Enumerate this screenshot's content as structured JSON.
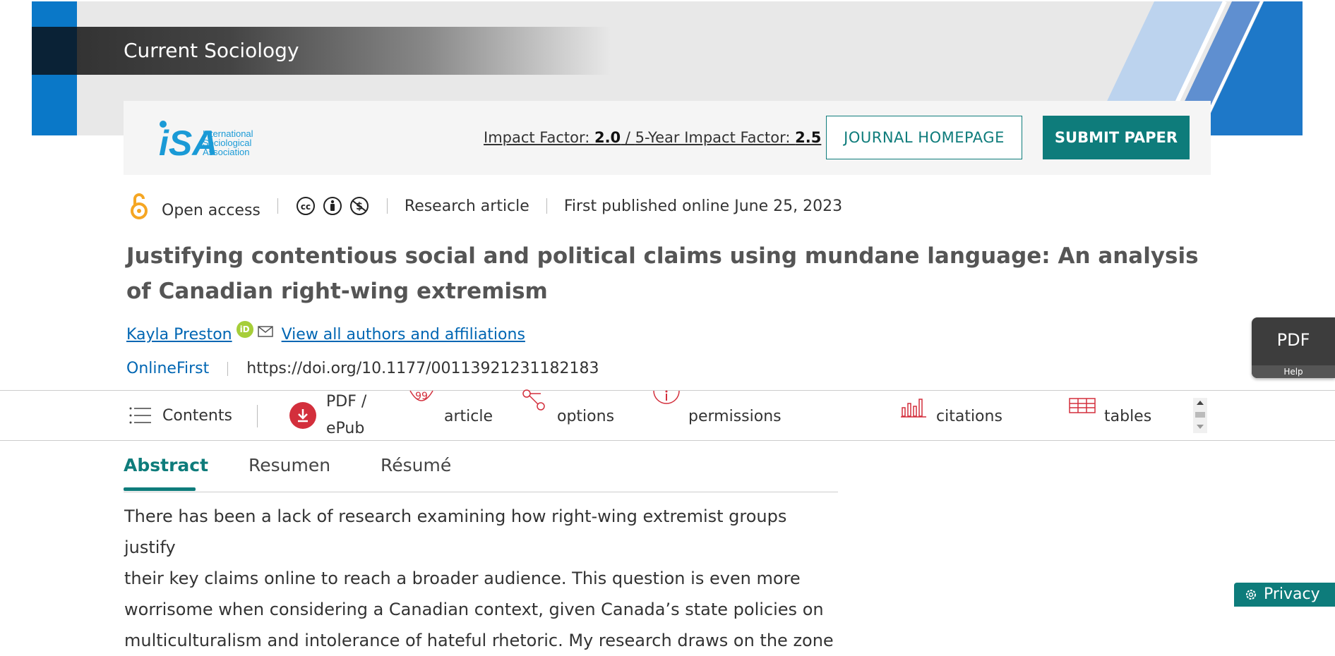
{
  "banner": {
    "journal_title": "Current Sociology"
  },
  "infobar": {
    "logo_text_lines": [
      "International",
      "Sociological",
      "Association"
    ],
    "impact_label": "Impact Factor: ",
    "impact_value": "2.0",
    "impact_divider": " / ",
    "five_year_label": "5-Year Impact Factor: ",
    "five_year_value": "2.5",
    "journal_homepage": "JOURNAL HOMEPAGE",
    "submit_paper": "SUBMIT PAPER"
  },
  "meta": {
    "open_access": "Open access",
    "article_type": "Research article",
    "published": "First published online June 25, 2023"
  },
  "article": {
    "title": "Justifying contentious social and political claims using mundane language: An analysis of Canadian right-wing extremism",
    "author": "Kayla Preston",
    "orcid_label": "iD",
    "view_authors": "View all authors and affiliations",
    "status_link": "OnlineFirst",
    "doi": "https://doi.org/10.1177/00113921231182183"
  },
  "pdf_float": {
    "label": "PDF",
    "help": "Help"
  },
  "toolbar": {
    "contents": "Contents",
    "pdf_line1": "PDF /",
    "pdf_line2": "ePub",
    "article": "article",
    "options": "options",
    "permissions": "permissions",
    "citations": "citations",
    "tables": "tables"
  },
  "tabs": [
    "Abstract",
    "Resumen",
    "Résumé"
  ],
  "abstract_lines": [
    "There has been a lack of research examining how right-wing extremist groups justify",
    "their key claims online to reach a broader audience. This question is even more",
    "worrisome when considering a Canadian context, given Canada’s state policies on",
    "multiculturalism and intolerance of hateful rhetoric. My research draws on the zone"
  ],
  "privacy": {
    "label": "Privacy"
  },
  "colors": {
    "teal": "#0e7c7b",
    "blue": "#0a78c8",
    "red": "#d32f3c",
    "orange": "#f5a623"
  }
}
